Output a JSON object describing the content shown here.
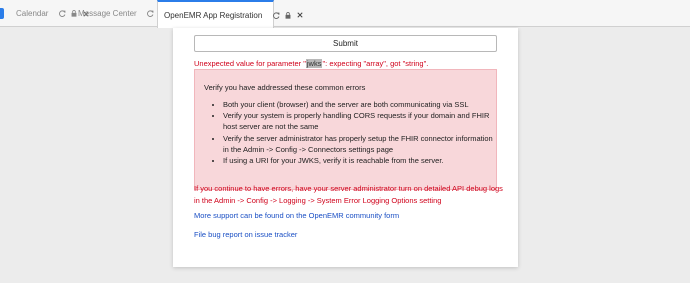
{
  "tabs": [
    {
      "label": "Calendar",
      "active": false
    },
    {
      "label": "Message Center",
      "active": false
    },
    {
      "label": "OpenEMR App Registration",
      "active": true
    }
  ],
  "form": {
    "submit_label": "Submit"
  },
  "error": {
    "prefix": "Unexpected value for parameter \"",
    "param": "jwks",
    "suffix": "\": expecting \"array\", got \"string\"."
  },
  "checklist": {
    "intro": "Verify you have addressed these common errors",
    "items": [
      "Both your client (browser) and the server are both communicating via SSL",
      "Verify your system is properly handling CORS requests if your domain and FHIR host server are not the same",
      "Verify the server administrator has properly setup the FHIR connector information in the Admin -> Config -> Connectors settings page",
      "If using a URI for your JWKS, verify it is reachable from the server."
    ]
  },
  "followup_error": "If you continue to have errors, have your server administrator turn on detailed API debug logs in the Admin -> Config -> Logging -> System Error Logging Options setting",
  "links": {
    "support": "More support can be found on the OpenEMR community form",
    "bug": "File bug report on issue tracker"
  },
  "colors": {
    "error_text": "#d0021b",
    "alert_bg": "#f8d7da",
    "link": "#1a4fc4",
    "active_tab_accent": "#2b7de9"
  }
}
